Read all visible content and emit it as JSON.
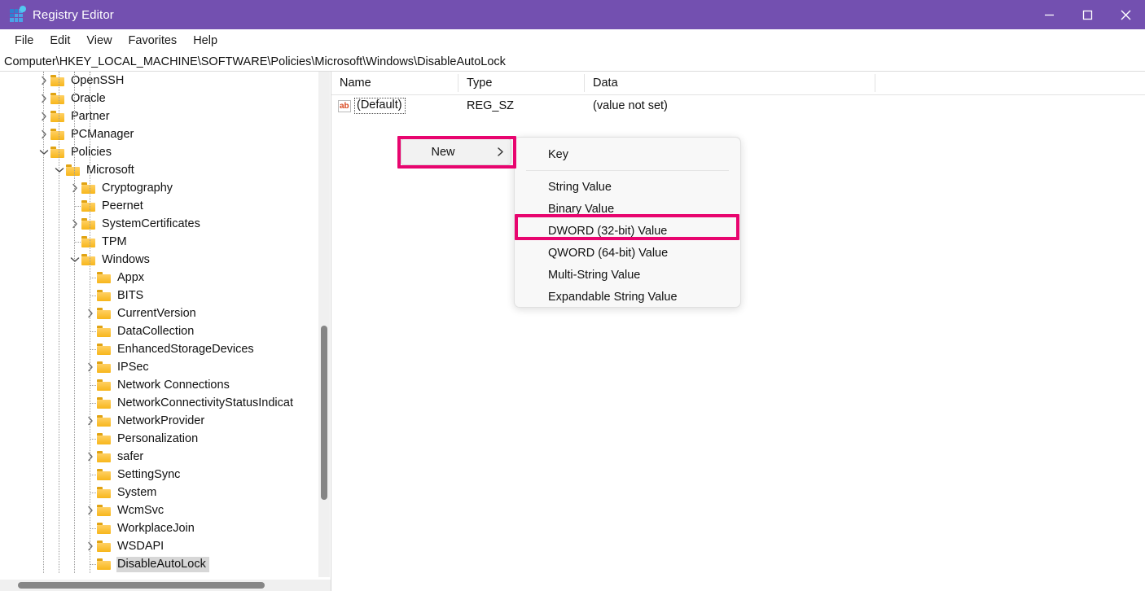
{
  "window": {
    "title": "Registry Editor",
    "icon": "registry-grid-icon",
    "accent_color": "#7350b0",
    "controls": {
      "minimize": "minimize-icon",
      "maximize": "maximize-icon",
      "close": "close-icon"
    }
  },
  "menubar": {
    "items": [
      {
        "label": "File"
      },
      {
        "label": "Edit"
      },
      {
        "label": "View"
      },
      {
        "label": "Favorites"
      },
      {
        "label": "Help"
      }
    ]
  },
  "address": {
    "path": "Computer\\HKEY_LOCAL_MACHINE\\SOFTWARE\\Policies\\Microsoft\\Windows\\DisableAutoLock"
  },
  "tree": {
    "items": [
      {
        "label": "OpenSSH",
        "depth": 1,
        "expander": "collapsed",
        "selected": false
      },
      {
        "label": "Oracle",
        "depth": 1,
        "expander": "collapsed",
        "selected": false
      },
      {
        "label": "Partner",
        "depth": 1,
        "expander": "collapsed",
        "selected": false
      },
      {
        "label": "PCManager",
        "depth": 1,
        "expander": "collapsed",
        "selected": false
      },
      {
        "label": "Policies",
        "depth": 1,
        "expander": "expanded",
        "selected": false
      },
      {
        "label": "Microsoft",
        "depth": 2,
        "expander": "expanded",
        "selected": false
      },
      {
        "label": "Cryptography",
        "depth": 3,
        "expander": "collapsed",
        "selected": false
      },
      {
        "label": "Peernet",
        "depth": 3,
        "expander": "none",
        "selected": false
      },
      {
        "label": "SystemCertificates",
        "depth": 3,
        "expander": "collapsed",
        "selected": false
      },
      {
        "label": "TPM",
        "depth": 3,
        "expander": "none",
        "selected": false
      },
      {
        "label": "Windows",
        "depth": 3,
        "expander": "expanded",
        "selected": false
      },
      {
        "label": "Appx",
        "depth": 4,
        "expander": "none",
        "selected": false
      },
      {
        "label": "BITS",
        "depth": 4,
        "expander": "none",
        "selected": false
      },
      {
        "label": "CurrentVersion",
        "depth": 4,
        "expander": "collapsed",
        "selected": false
      },
      {
        "label": "DataCollection",
        "depth": 4,
        "expander": "none",
        "selected": false
      },
      {
        "label": "EnhancedStorageDevices",
        "depth": 4,
        "expander": "none",
        "selected": false
      },
      {
        "label": "IPSec",
        "depth": 4,
        "expander": "collapsed",
        "selected": false
      },
      {
        "label": "Network Connections",
        "depth": 4,
        "expander": "none",
        "selected": false
      },
      {
        "label": "NetworkConnectivityStatusIndicat",
        "depth": 4,
        "expander": "none",
        "selected": false
      },
      {
        "label": "NetworkProvider",
        "depth": 4,
        "expander": "collapsed",
        "selected": false
      },
      {
        "label": "Personalization",
        "depth": 4,
        "expander": "none",
        "selected": false
      },
      {
        "label": "safer",
        "depth": 4,
        "expander": "collapsed",
        "selected": false
      },
      {
        "label": "SettingSync",
        "depth": 4,
        "expander": "none",
        "selected": false
      },
      {
        "label": "System",
        "depth": 4,
        "expander": "none",
        "selected": false
      },
      {
        "label": "WcmSvc",
        "depth": 4,
        "expander": "collapsed",
        "selected": false
      },
      {
        "label": "WorkplaceJoin",
        "depth": 4,
        "expander": "none",
        "selected": false
      },
      {
        "label": "WSDAPI",
        "depth": 4,
        "expander": "collapsed",
        "selected": false
      },
      {
        "label": "DisableAutoLock",
        "depth": 4,
        "expander": "none",
        "selected": true
      }
    ]
  },
  "value_list": {
    "columns": [
      "Name",
      "Type",
      "Data"
    ],
    "rows": [
      {
        "icon": "string-value-icon",
        "icon_text": "ab",
        "name": "(Default)",
        "type": "REG_SZ",
        "data": "(value not set)"
      }
    ]
  },
  "context_menu": {
    "parent_item": {
      "label": "New",
      "submenu_arrow": "chevron-right-icon",
      "highlighted": true
    },
    "submenu_items": [
      {
        "label": "Key",
        "highlighted": false,
        "separator_after": true
      },
      {
        "label": "String Value",
        "highlighted": false,
        "separator_after": false
      },
      {
        "label": "Binary Value",
        "highlighted": false,
        "separator_after": false
      },
      {
        "label": "DWORD (32-bit) Value",
        "highlighted": true,
        "separator_after": false
      },
      {
        "label": "QWORD (64-bit) Value",
        "highlighted": false,
        "separator_after": false
      },
      {
        "label": "Multi-String Value",
        "highlighted": false,
        "separator_after": false
      },
      {
        "label": "Expandable String Value",
        "highlighted": false,
        "separator_after": false
      }
    ]
  },
  "annotations": {
    "color": "#e8056f",
    "boxes": [
      {
        "target": "New"
      },
      {
        "target": "DWORD (32-bit) Value"
      }
    ]
  }
}
